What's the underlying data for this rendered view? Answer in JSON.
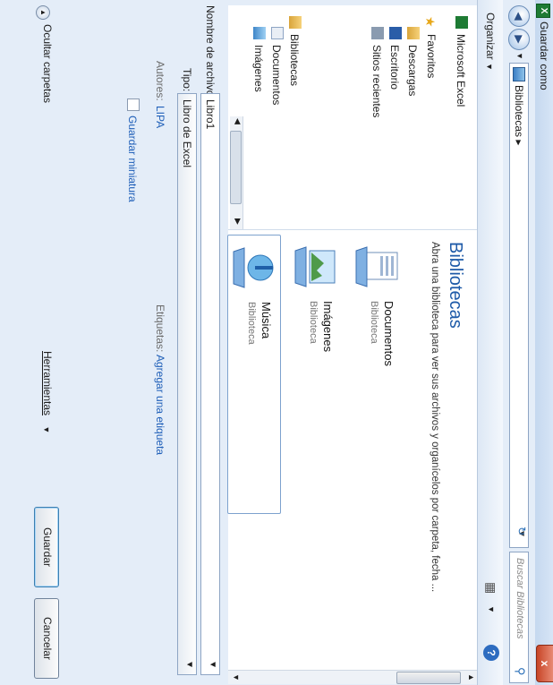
{
  "window": {
    "title": "Guardar como",
    "close_label": "x",
    "app_icon": "X"
  },
  "address": {
    "crumb": "Bibliotecas",
    "search_placeholder": "Buscar Bibliotecas"
  },
  "toolbar": {
    "organize": "Organizar"
  },
  "nav": {
    "items": [
      {
        "label": "Microsoft Excel",
        "icon": "excel-icon"
      },
      {
        "label": "Favoritos",
        "icon": "star-icon"
      },
      {
        "label": "Descargas",
        "icon": "download-folder-icon"
      },
      {
        "label": "Escritorio",
        "icon": "desktop-icon"
      },
      {
        "label": "Sitios recientes",
        "icon": "recent-icon"
      },
      {
        "label": "Bibliotecas",
        "icon": "library-icon"
      },
      {
        "label": "Documentos",
        "icon": "documents-icon"
      },
      {
        "label": "Imágenes",
        "icon": "pictures-icon"
      }
    ]
  },
  "libraries": {
    "title": "Bibliotecas",
    "description": "Abra una biblioteca para ver sus archivos y organícelos por carpeta, fecha ...",
    "items": [
      {
        "name": "Documentos",
        "type": "Biblioteca"
      },
      {
        "name": "Imágenes",
        "type": "Biblioteca"
      },
      {
        "name": "Música",
        "type": "Biblioteca"
      }
    ]
  },
  "form": {
    "filename_label": "Nombre de archivo:",
    "filename_value": "Libro1",
    "type_label": "Tipo:",
    "type_value": "Libro de Excel",
    "authors_label": "Autores:",
    "authors_value": "LIPA",
    "tags_label": "Etiquetas:",
    "tags_value": "Agregar una etiqueta",
    "thumbnail_label": "Guardar miniatura",
    "hide_folders": "Ocultar carpetas",
    "tools": "Herramientas",
    "save": "Guardar",
    "cancel": "Cancelar"
  }
}
